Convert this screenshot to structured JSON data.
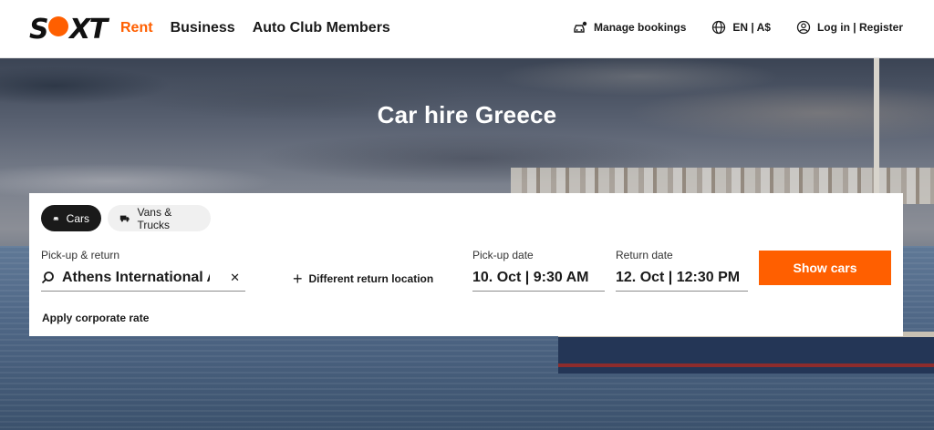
{
  "header": {
    "logo": "SIXT",
    "nav": [
      {
        "label": "Rent",
        "active": true
      },
      {
        "label": "Business",
        "active": false
      },
      {
        "label": "Auto Club Members",
        "active": false
      }
    ],
    "manage_bookings": {
      "label": "Manage bookings",
      "icon": "car-manage-icon"
    },
    "language": {
      "label": "EN | A$",
      "icon": "globe-icon"
    },
    "account": {
      "label": "Log in | Register",
      "icon": "user-icon"
    }
  },
  "hero": {
    "title": "Car hire Greece"
  },
  "booking": {
    "vehicle_tabs": [
      {
        "label": "Cars",
        "icon": "car-icon",
        "selected": true
      },
      {
        "label": "Vans & Trucks",
        "icon": "truck-icon",
        "selected": false
      }
    ],
    "pickup_return": {
      "label": "Pick-up & return",
      "value": "Athens International Airport",
      "clear_icon": "close-icon"
    },
    "different_return": "Different return location",
    "pickup_date": {
      "label": "Pick-up date",
      "value": "10. Oct | 9:30 AM"
    },
    "return_date": {
      "label": "Return date",
      "value": "12. Oct | 12:30 PM"
    },
    "show_cars": "Show cars",
    "corporate_rate": "Apply corporate rate"
  },
  "colors": {
    "brand_orange": "#ff5f00",
    "dark": "#1a1a1a"
  }
}
